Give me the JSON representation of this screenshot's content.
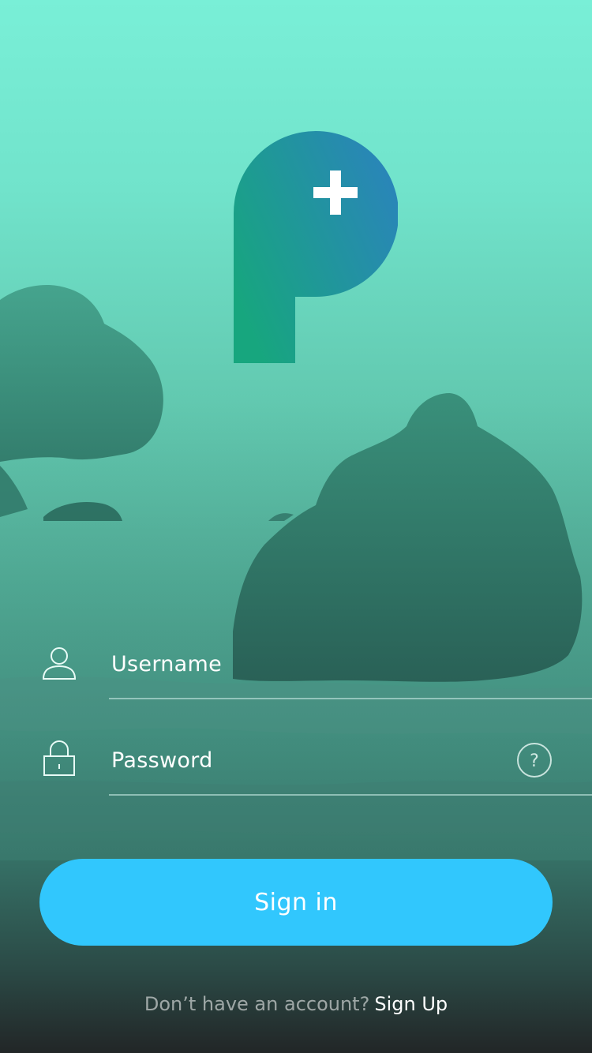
{
  "login": {
    "username_placeholder": "Username",
    "password_placeholder": "Password",
    "help_symbol": "?",
    "sign_in_label": "Sign in",
    "no_account_text": "Don’t have an account?",
    "sign_up_label": "Sign Up"
  },
  "icons": {
    "user": "user-icon",
    "lock": "lock-icon",
    "help": "help-icon",
    "logo": "p-plus-logo"
  },
  "colors": {
    "background_top": "#79efd7",
    "background_bottom": "#222627",
    "logo_gradient_start": "#17a67e",
    "logo_gradient_end": "#2b83bd",
    "button": "#31c7fd",
    "text": "#ffffff"
  }
}
